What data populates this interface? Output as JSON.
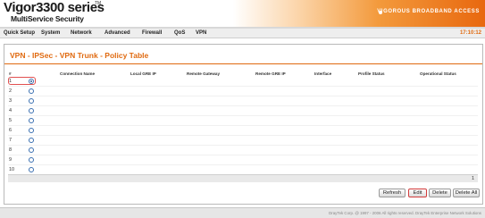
{
  "header": {
    "brand": "Vigor3300 series",
    "tm": "TM",
    "subtitle": "MultiService Security",
    "slogan": "VIGOROUS BROADBAND ACCESS"
  },
  "menu": {
    "items": [
      "Quick Setup",
      "System",
      "Network",
      "Advanced",
      "Firewall",
      "QoS",
      "VPN"
    ],
    "clock": "17:10:12"
  },
  "page": {
    "title": "VPN - IPSec - VPN Trunk - Policy Table"
  },
  "table": {
    "columns": [
      "#",
      "Connection Name",
      "Local GRE IP",
      "Remote Gateway",
      "Remote GRE IP",
      "Interface",
      "Profile Status",
      "Operational Status"
    ],
    "rows": [
      {
        "index": "1",
        "selected": true
      },
      {
        "index": "2",
        "selected": false
      },
      {
        "index": "3",
        "selected": false
      },
      {
        "index": "4",
        "selected": false
      },
      {
        "index": "5",
        "selected": false
      },
      {
        "index": "6",
        "selected": false
      },
      {
        "index": "7",
        "selected": false
      },
      {
        "index": "8",
        "selected": false
      },
      {
        "index": "9",
        "selected": false
      },
      {
        "index": "10",
        "selected": false
      }
    ],
    "page": "1"
  },
  "buttons": {
    "refresh": "Refresh",
    "edit": "Edit",
    "delete": "Delete",
    "delete_all": "Delete All"
  },
  "footer": {
    "text": "DrayTek Corp. @ 1997 - 2006 All rights reserved. DrayTek Enterprise Network Solutions"
  },
  "colors": {
    "accent": "#e06a10",
    "selection_border": "#e15050"
  }
}
